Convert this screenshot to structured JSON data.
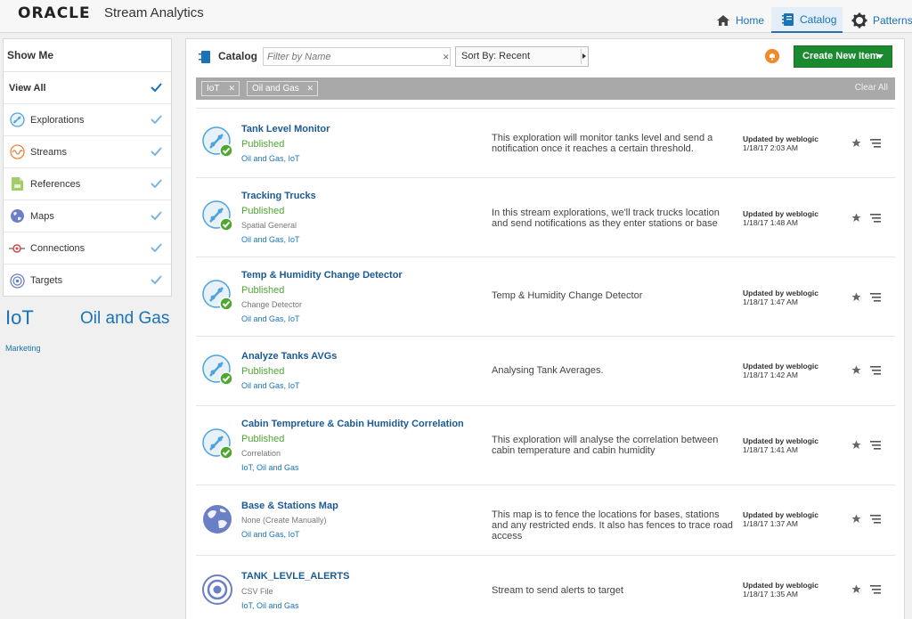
{
  "header": {
    "logo": "ORACLE",
    "product": "Stream Analytics",
    "nav": [
      {
        "label": "Home"
      },
      {
        "label": "Catalog"
      },
      {
        "label": "Patterns"
      }
    ]
  },
  "showme": {
    "title": "Show Me",
    "items": [
      {
        "label": "View All"
      },
      {
        "label": "Explorations"
      },
      {
        "label": "Streams"
      },
      {
        "label": "References"
      },
      {
        "label": "Maps"
      },
      {
        "label": "Connections"
      },
      {
        "label": "Targets"
      }
    ]
  },
  "tagcloud": [
    "IoT",
    "Oil and Gas",
    "Marketing"
  ],
  "toolbar": {
    "title": "Catalog",
    "filter_placeholder": "Filter by Name",
    "sort_label": "Sort By: Recent",
    "create_label": "Create New Item"
  },
  "filters": {
    "chips": [
      "IoT",
      "Oil and Gas"
    ],
    "clear_label": "Clear All"
  },
  "items": [
    {
      "name": "Tank Level Monitor",
      "status": "Published",
      "type": "",
      "tags": "Oil and Gas, IoT",
      "description": "This exploration will monitor tanks level and send a notification once it reaches a certain threshold.",
      "updated_by": "Updated by weblogic",
      "updated_at": "1/18/17 2:03 AM",
      "icon": "exploration-icon"
    },
    {
      "name": "Tracking Trucks",
      "status": "Published",
      "type": "Spatial General",
      "tags": "Oil and Gas, IoT",
      "description": "In this stream explorations, we'll track trucks location and send notifications as they enter stations or base",
      "updated_by": "Updated by weblogic",
      "updated_at": "1/18/17 1:48 AM",
      "icon": "exploration-icon"
    },
    {
      "name": "Temp & Humidity Change Detector",
      "status": "Published",
      "type": "Change Detector",
      "tags": "Oil and Gas, IoT",
      "description": "Temp & Humidity Change Detector",
      "updated_by": "Updated by weblogic",
      "updated_at": "1/18/17 1:47 AM",
      "icon": "exploration-icon"
    },
    {
      "name": "Analyze Tanks AVGs",
      "status": "Published",
      "type": "",
      "tags": "Oil and Gas, IoT",
      "description": "Analysing Tank Averages.",
      "updated_by": "Updated by weblogic",
      "updated_at": "1/18/17 1:42 AM",
      "icon": "exploration-icon"
    },
    {
      "name": "Cabin Tempreture & Cabin Humidity Correlation",
      "status": "Published",
      "type": "Correlation",
      "tags": "IoT, Oil and Gas",
      "description": "This exploration will analyse the correlation between cabin temperature and cabin humidity",
      "updated_by": "Updated by weblogic",
      "updated_at": "1/18/17 1:41 AM",
      "icon": "exploration-icon"
    },
    {
      "name": "Base & Stations Map",
      "status": "",
      "type": "None (Create Manually)",
      "tags": "Oil and Gas, IoT",
      "description": "This map is to fence the locations for bases, stations and any restricted ends. It also has fences to trace road access",
      "updated_by": "Updated by weblogic",
      "updated_at": "1/18/17 1:37 AM",
      "icon": "map-icon"
    },
    {
      "name": "TANK_LEVLE_ALERTS",
      "status": "",
      "type": "CSV File",
      "tags": "IoT, Oil and Gas",
      "description": "Stream to send alerts to target",
      "updated_by": "Updated by weblogic",
      "updated_at": "1/18/17 1:35 AM",
      "icon": "target-icon"
    }
  ]
}
